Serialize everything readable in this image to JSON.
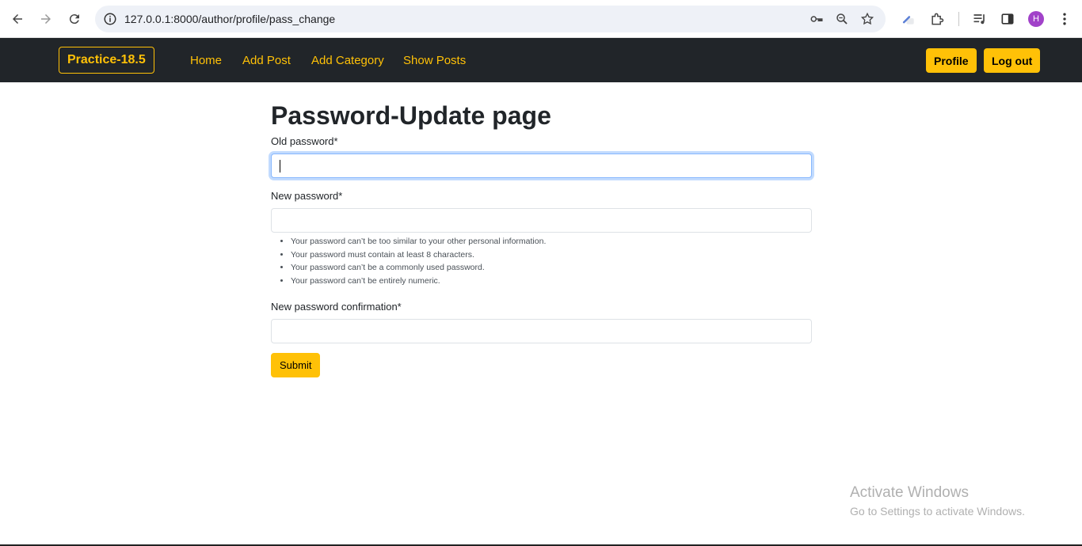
{
  "browser": {
    "url": "127.0.0.1:8000/author/profile/pass_change",
    "avatar_letter": "H"
  },
  "navbar": {
    "brand": "Practice-18.5",
    "links": [
      "Home",
      "Add Post",
      "Add Category",
      "Show Posts"
    ],
    "profile_label": "Profile",
    "logout_label": "Log out"
  },
  "form": {
    "title": "Password-Update page",
    "old_password_label": "Old password*",
    "new_password_label": "New password*",
    "help": [
      "Your password can’t be too similar to your other personal information.",
      "Your password must contain at least 8 characters.",
      "Your password can’t be a commonly used password.",
      "Your password can’t be entirely numeric."
    ],
    "confirm_label": "New password confirmation*",
    "submit_label": "Submit"
  },
  "watermark": {
    "line1": "Activate Windows",
    "line2": "Go to Settings to activate Windows."
  },
  "colors": {
    "accent": "#ffc107",
    "navbar": "#212529"
  }
}
